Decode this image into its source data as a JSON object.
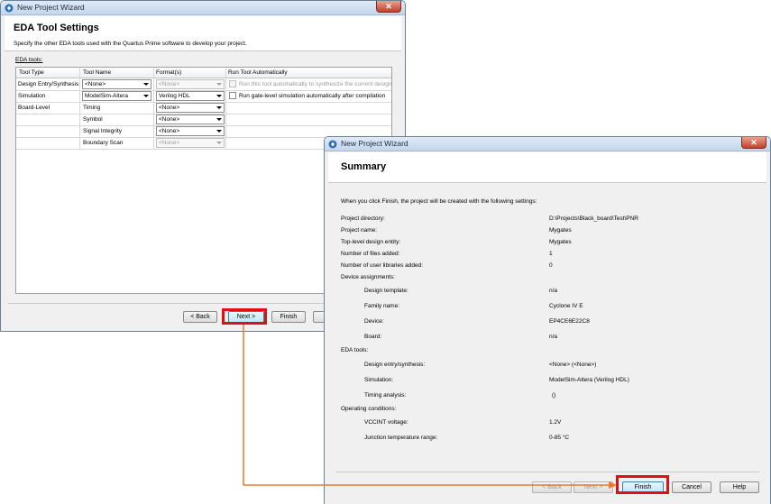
{
  "window1": {
    "title": "New Project Wizard",
    "heading": "EDA Tool Settings",
    "description": "Specify the other EDA tools used with the Quartus Prime software to develop your project.",
    "section_label": "EDA tools:",
    "columns": [
      "Tool Type",
      "Tool Name",
      "Format(s)",
      "Run Tool Automatically"
    ],
    "rows": [
      {
        "tool_type": "Design Entry/Synthesis",
        "tool_name": "<None>",
        "format": "<None>",
        "run_text": "Run this tool automatically to synthesize the current design"
      },
      {
        "tool_type": "Simulation",
        "tool_name": "ModelSim-Altera",
        "format": "Verilog HDL",
        "run_text": "Run gate-level simulation automatically after compilation"
      },
      {
        "tool_type": "Board-Level",
        "tool_name": "Timing",
        "format": "<None>",
        "run_text": ""
      },
      {
        "tool_type": "",
        "tool_name": "Symbol",
        "format": "<None>",
        "run_text": ""
      },
      {
        "tool_type": "",
        "tool_name": "Signal Integrity",
        "format": "<None>",
        "run_text": ""
      },
      {
        "tool_type": "",
        "tool_name": "Boundary Scan",
        "format": "<None>",
        "run_text": ""
      }
    ],
    "buttons": {
      "back": "< Back",
      "next": "Next >",
      "finish": "Finish"
    }
  },
  "window2": {
    "title": "New Project Wizard",
    "heading": "Summary",
    "intro": "When you click Finish, the project will be created with the following settings:",
    "settings": [
      {
        "label": "Project directory:",
        "value": "D:\\Projects\\Black_board\\Test\\PNR"
      },
      {
        "label": "Project name:",
        "value": "Mygates"
      },
      {
        "label": "Top-level design entity:",
        "value": "Mygates"
      },
      {
        "label": "Number of files added:",
        "value": "1"
      },
      {
        "label": "Number of user libraries added:",
        "value": "0"
      }
    ],
    "device_section": "Device assignments:",
    "device": [
      {
        "label": "Design template:",
        "value": "n/a"
      },
      {
        "label": "Family name:",
        "value": "Cyclone IV E"
      },
      {
        "label": "Device:",
        "value": "EP4CE6E22C8"
      },
      {
        "label": "Board:",
        "value": "n/a"
      }
    ],
    "eda_section": "EDA tools:",
    "eda": [
      {
        "label": "Design entry/synthesis:",
        "value": "<None> (<None>)"
      },
      {
        "label": "Simulation:",
        "value": "ModelSim-Altera (Verilog HDL)"
      },
      {
        "label": "Timing analysis:",
        "value": "()"
      }
    ],
    "operating_section": "Operating conditions:",
    "operating": [
      {
        "label": "VCCINT voltage:",
        "value": "1.2V"
      },
      {
        "label": "Junction temperature range:",
        "value": "0-85 °C"
      }
    ],
    "buttons": {
      "back": "< Back",
      "next": "Next >",
      "finish": "Finish",
      "cancel": "Cancel",
      "help": "Help"
    }
  },
  "colors": {
    "highlight": "#e01010",
    "connector": "#f07828",
    "title_bar": "#c3d6ec"
  },
  "icons": [
    "app-icon",
    "close-icon",
    "dropdown-arrow-icon",
    "checkbox-icon"
  ]
}
